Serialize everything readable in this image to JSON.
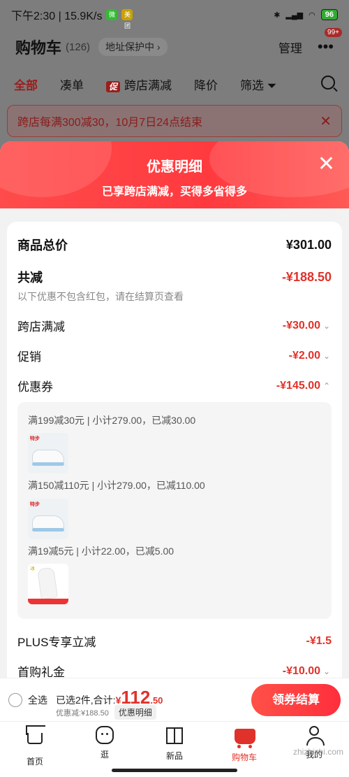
{
  "status_bar": {
    "time_speed": "下午2:30 | 15.9K/s",
    "app_badge_1": "微",
    "app_badge_2": "美团",
    "battery": "96"
  },
  "cart_header": {
    "title": "购物车",
    "count": "(126)",
    "address_chip": "地址保护中 ›",
    "manage": "管理",
    "more_badge": "99+"
  },
  "filter_tabs": [
    {
      "label": "全部"
    },
    {
      "label": "凑单"
    },
    {
      "tag": "促",
      "label": "跨店满减"
    },
    {
      "label": "降价"
    },
    {
      "label": "筛选"
    }
  ],
  "notice": {
    "text": "跨店每满300减30，10月7日24点结束",
    "close": "✕"
  },
  "sheet": {
    "title": "优惠明细",
    "subtitle": "已享跨店满减，买得多省得多",
    "close": "✕",
    "total_label": "商品总价",
    "total_value": "¥301.00",
    "reduce_label": "共减",
    "reduce_value": "-¥188.50",
    "hint": "以下优惠不包含红包，请在结算页查看",
    "items": [
      {
        "label": "跨店满减",
        "value": "-¥30.00",
        "chev": "⌄"
      },
      {
        "label": "促销",
        "value": "-¥2.00",
        "chev": "⌄"
      },
      {
        "label": "优惠券",
        "value": "-¥145.00",
        "chev": "⌃"
      }
    ],
    "coupons": [
      {
        "line": "满199减30元 | 小计279.00，已减30.00",
        "thumb_brand": "特步"
      },
      {
        "line": "满150减110元 | 小计279.00，已减110.00",
        "thumb_brand": "特步"
      },
      {
        "line": "满19减5元 | 小计22.00，已减5.00",
        "thumb_brand": "冰"
      }
    ],
    "plus_label": "PLUS专享立减",
    "plus_value": "-¥1.5",
    "gift_label": "首购礼金",
    "gift_value": "-¥10.00",
    "gift_chev": "⌄"
  },
  "checkout": {
    "select_all": "全选",
    "selected": "已选2件,合计:",
    "yen": "¥",
    "amount_int": "112",
    "amount_dec": ".50",
    "discount_text": "优惠减:¥188.50",
    "discount_detail": "优惠明细",
    "pay_button": "领券结算"
  },
  "tabbar": [
    {
      "label": "首页"
    },
    {
      "label": "逛"
    },
    {
      "label": "新品"
    },
    {
      "label": "购物车"
    },
    {
      "label": "我的"
    }
  ],
  "watermark": "zhizhizhi.com",
  "colors": {
    "accent": "#e0322a",
    "sheet_header": "#ff4040"
  }
}
